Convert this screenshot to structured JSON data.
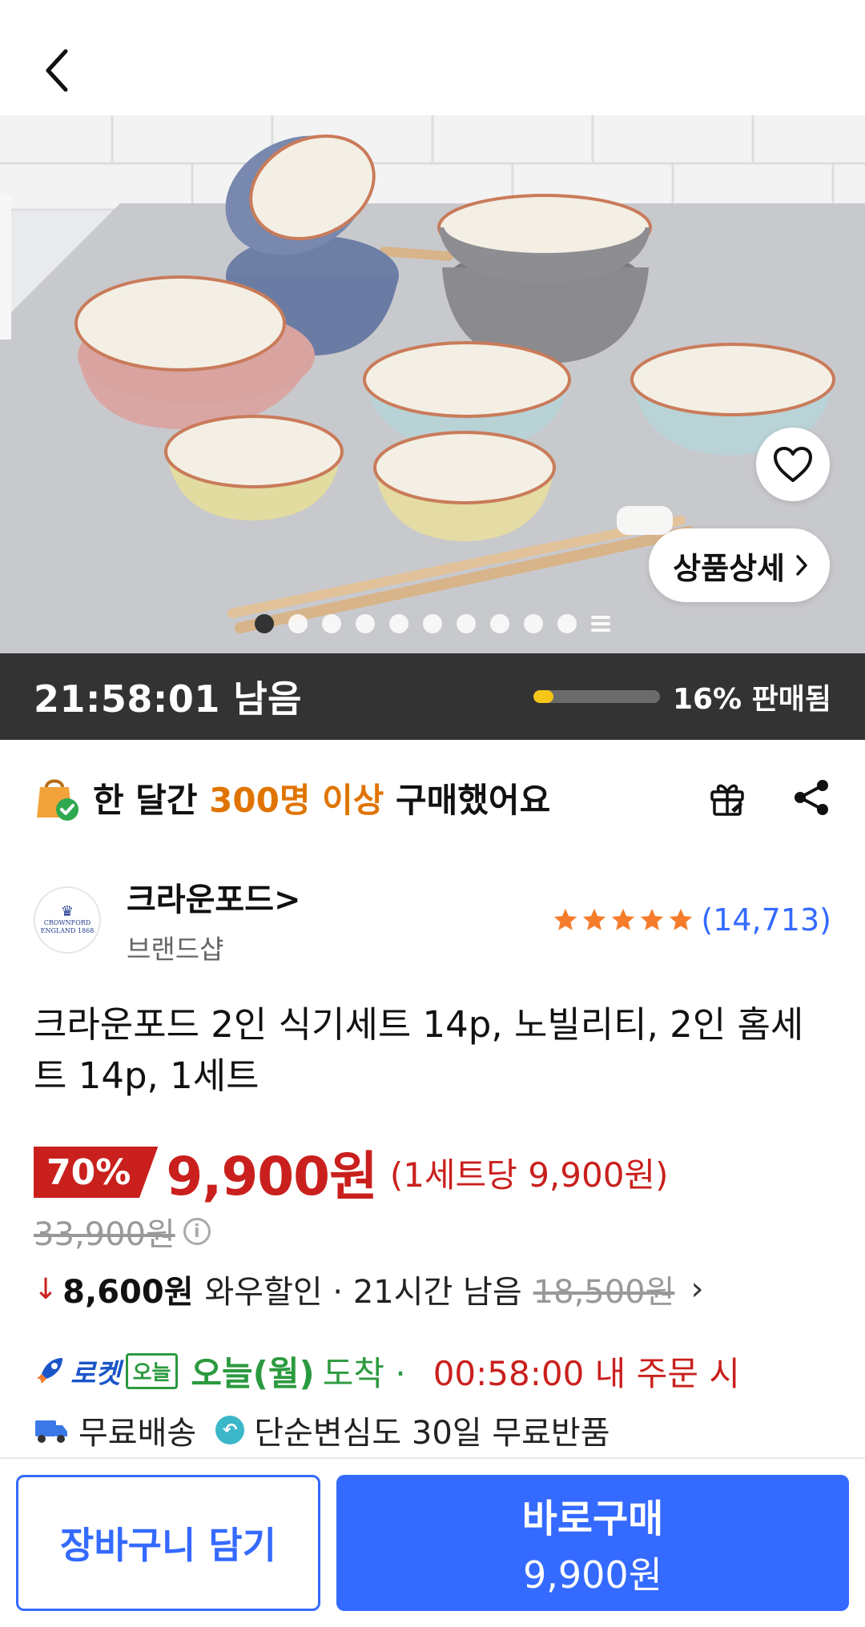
{
  "header": {
    "back_icon": "chevron-left-icon"
  },
  "hero": {
    "detail_label": "상품상세",
    "slide_index": 1,
    "slide_count": 10
  },
  "deal": {
    "time_left": "21:58:01",
    "time_suffix": "남음",
    "sold_percent": 16,
    "sold_label": "16% 판매됨"
  },
  "buyers": {
    "prefix": "한 달간",
    "highlight": "300명 이상",
    "suffix": "구매했어요"
  },
  "brand": {
    "name": "크라운포드",
    "chevron": ">",
    "subtitle": "브랜드샵",
    "logo_text_1": "CROWNFORD",
    "logo_text_2": "ENGLAND 1868",
    "rating_stars": 5,
    "review_count": "(14,713)"
  },
  "product": {
    "title": "크라운포드 2인 식기세트 14p, 노빌리티, 2인 홈세트 14p, 1세트"
  },
  "price": {
    "discount": "70%",
    "sale_price": "9,900원",
    "unit_price": "(1세트당 9,900원)",
    "original_price": "33,900원",
    "info_icon": "i"
  },
  "wow": {
    "arrow": "↓",
    "price": "8,600원",
    "text": "와우할인 · 21시간 남음",
    "strike_price": "18,500원",
    "chevron": "›"
  },
  "delivery": {
    "rocket_label": "로켓",
    "today_badge": "오늘",
    "arrive_bold": "오늘(월)",
    "arrive_text": "도착 ·",
    "order_time": "00:58:00 내 주문 시"
  },
  "benefits": {
    "free_shipping": "무료배송",
    "return_text": "단순변심도 30일 무료반품"
  },
  "bottom": {
    "cart_label": "장바구니 담기",
    "buy_label": "바로구매",
    "buy_price": "9,900원"
  },
  "colors": {
    "accent_blue": "#346aff",
    "price_red": "#c9201d",
    "highlight_orange": "#e07400",
    "delivery_green": "#2b9a3f",
    "timer_bg": "#333333",
    "progress_yellow": "#f5c518",
    "star_orange": "#f57c2b"
  }
}
